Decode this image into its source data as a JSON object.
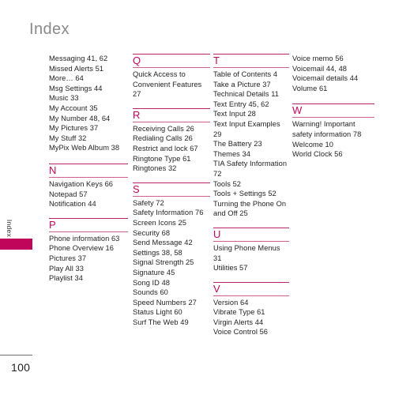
{
  "page": {
    "title": "Index",
    "side_tab_label": "Index",
    "page_number": "100",
    "accent_color": "#c0065a",
    "rule_color": "#b8236b",
    "title_color": "#8a8a8d",
    "text_color": "#231f20"
  },
  "columns": [
    {
      "continuation": [
        "Messaging 41, 62",
        "Missed Alerts 51",
        "More… 64",
        "Msg Settings 44",
        "Music 33",
        "My Account 35",
        "My Number 48, 64",
        "My Pictures 37",
        "My Stuff 32",
        "MyPix Web Album 38"
      ],
      "sections": [
        {
          "letter": "N",
          "entries": [
            "Navigation Keys 66",
            "Notepad 57",
            "Notification 44"
          ]
        },
        {
          "letter": "P",
          "entries": [
            "Phone information 63",
            "Phone Overview 16",
            "Pictures 37",
            "Play All 33",
            "Playlist 34"
          ]
        }
      ]
    },
    {
      "continuation": [],
      "sections": [
        {
          "letter": "Q",
          "entries": [
            "Quick Access to Convenient Features 27"
          ]
        },
        {
          "letter": "R",
          "entries": [
            "Receiving Calls 26",
            "Redialing Calls 26",
            "Restrict and lock 67",
            "Ringtone Type 61",
            "Ringtones 32"
          ]
        },
        {
          "letter": "S",
          "entries": [
            "Safety 72",
            "Safety Information 76",
            "Screen Icons 25",
            "Security 68",
            "Send Message 42",
            "Settings 38, 58",
            "Signal Strength 25",
            "Signature 45",
            "Song ID 48",
            "Sounds 60",
            "Speed Numbers 27",
            "Status Light 60",
            "Surf The Web 49"
          ]
        }
      ]
    },
    {
      "continuation": [],
      "sections": [
        {
          "letter": "T",
          "entries": [
            "Table of Contents 4",
            "Take a Picture 37",
            "Technical Details 11",
            "Text Entry 45, 62",
            "Text Input 28",
            "Text Input Examples 29",
            "The Battery 23",
            "Themes 34",
            "TIA Safety Information 72",
            "Tools 52",
            "Tools + Settings 52",
            "Turning the Phone On and Off 25"
          ]
        },
        {
          "letter": "U",
          "entries": [
            "Using Phone Menus 31",
            "Utilities 57"
          ]
        },
        {
          "letter": "V",
          "entries": [
            "Version 64",
            "Vibrate Type 61",
            "Virgin Alerts 44",
            "Voice Control 56"
          ]
        }
      ]
    },
    {
      "continuation": [
        "Voice memo 56",
        "Voicemail 44, 48",
        "Voicemail details 44",
        "Volume 61"
      ],
      "sections": [
        {
          "letter": "W",
          "entries": [
            "Warning! Important safety information 78",
            "Welcome 10",
            "World Clock 56"
          ]
        }
      ]
    }
  ]
}
